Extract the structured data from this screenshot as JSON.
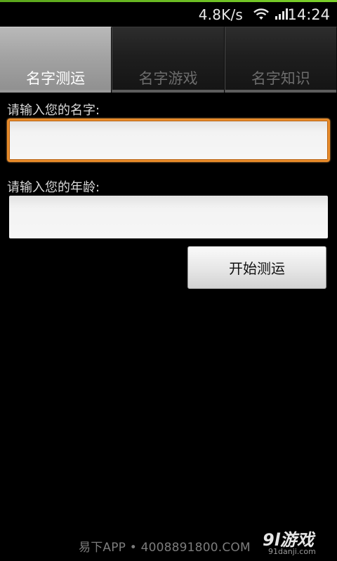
{
  "status_bar": {
    "speed": "4.8K/s",
    "time": "14:24",
    "wifi_icon": "wifi-icon",
    "signal_icon": "signal-icon"
  },
  "tabs": [
    {
      "label": "名字测运",
      "active": true
    },
    {
      "label": "名字游戏",
      "active": false
    },
    {
      "label": "名字知识",
      "active": false
    }
  ],
  "form": {
    "name_label": "请输入您的名字:",
    "name_value": "",
    "age_label": "请输入您的年龄:",
    "age_value": "",
    "start_button": "开始测运"
  },
  "watermark": {
    "text": "易下APP • 4008891800.COM",
    "logo": "9l游戏",
    "logo_sub": "91danji.com"
  },
  "colors": {
    "background": "#000000",
    "focus_border": "#e88b2a",
    "accent_line": "#5aa51c"
  }
}
